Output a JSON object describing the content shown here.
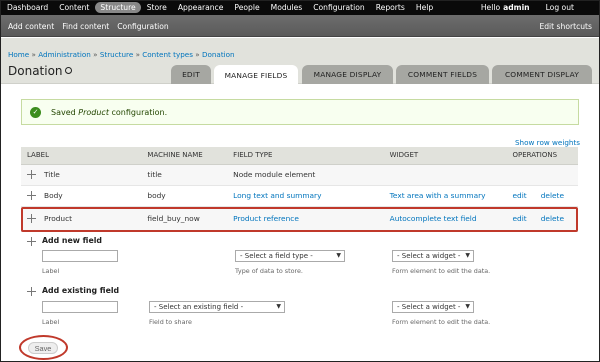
{
  "toolbar": {
    "items": [
      "Dashboard",
      "Content",
      "Structure",
      "Store",
      "Appearance",
      "People",
      "Modules",
      "Configuration",
      "Reports",
      "Help"
    ],
    "active_item": "Structure",
    "hello": "Hello",
    "username": "admin",
    "logout": "Log out"
  },
  "shortcuts": {
    "items": [
      "Add content",
      "Find content",
      "Configuration"
    ],
    "edit": "Edit shortcuts"
  },
  "breadcrumb": {
    "items": [
      "Home",
      "Administration",
      "Structure",
      "Content types",
      "Donation"
    ],
    "separator": "»"
  },
  "page": {
    "title": "Donation"
  },
  "tabs": [
    {
      "label": "EDIT",
      "active": false
    },
    {
      "label": "MANAGE FIELDS",
      "active": true
    },
    {
      "label": "MANAGE DISPLAY",
      "active": false
    },
    {
      "label": "COMMENT FIELDS",
      "active": false
    },
    {
      "label": "COMMENT DISPLAY",
      "active": false
    }
  ],
  "message": {
    "prefix": "Saved",
    "emphasis": "Product",
    "suffix": "configuration.",
    "icon": "check-icon",
    "color": "#3c8c1d"
  },
  "table": {
    "show_row_weights": "Show row weights",
    "headers": [
      "LABEL",
      "MACHINE NAME",
      "FIELD TYPE",
      "WIDGET",
      "OPERATIONS"
    ],
    "rows": [
      {
        "label": "Title",
        "machine": "title",
        "type": "Node module element",
        "widget": "",
        "edit": "",
        "delete": ""
      },
      {
        "label": "Body",
        "machine": "body",
        "type": "Long text and summary",
        "widget": "Text area with a summary",
        "edit": "edit",
        "delete": "delete"
      },
      {
        "label": "Product",
        "machine": "field_buy_now",
        "type": "Product reference",
        "widget": "Autocomplete text field",
        "edit": "edit",
        "delete": "delete"
      }
    ]
  },
  "add_new": {
    "title": "Add new field",
    "label_hint": "Label",
    "field_type_select": "- Select a field type -",
    "field_type_hint": "Type of data to store.",
    "widget_select": "- Select a widget -",
    "widget_hint": "Form element to edit the data."
  },
  "add_existing": {
    "title": "Add existing field",
    "label_hint": "Label",
    "field_select": "- Select an existing field -",
    "field_hint": "Field to share",
    "widget_select": "- Select a widget -",
    "widget_hint": "Form element to edit the data."
  },
  "save": {
    "label": "Save"
  },
  "colors": {
    "highlight": "#c0392b",
    "link": "#0074bd",
    "toolbar": "#0a0a0a",
    "header": "#e1e2dc"
  }
}
